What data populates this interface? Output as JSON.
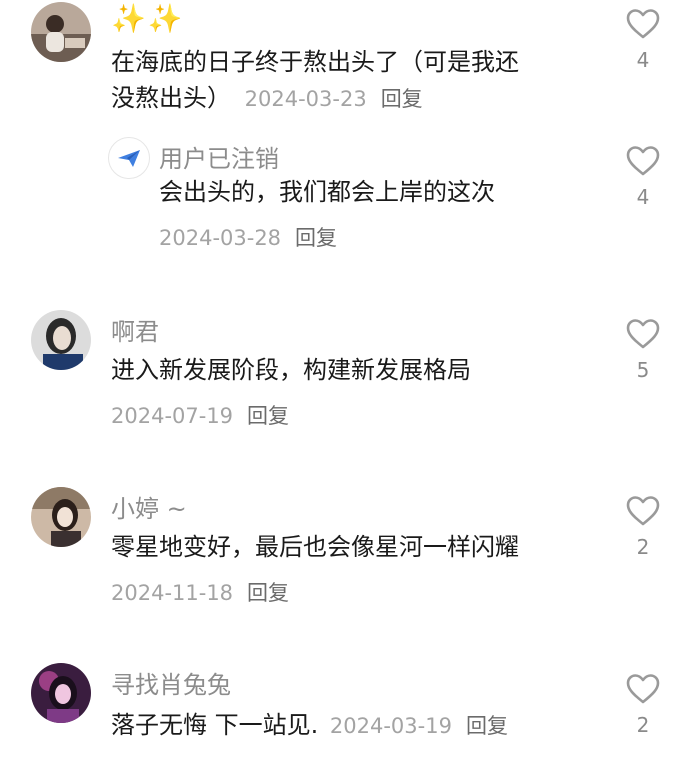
{
  "comments": [
    {
      "username": "✨✨",
      "content_part1": "在海底的日子终于熬出头了（可是我还",
      "content_part2": "没熬出头）",
      "date": "2024-03-23",
      "reply_label": "回复",
      "likes": "4",
      "reply": {
        "username": "用户已注销",
        "content": "会出头的，我们都会上岸的这次",
        "date": "2024-03-28",
        "reply_label": "回复",
        "likes": "4"
      }
    },
    {
      "username": "啊君",
      "content": "进入新发展阶段，构建新发展格局",
      "date": "2024-07-19",
      "reply_label": "回复",
      "likes": "5"
    },
    {
      "username": "小婷 ~",
      "content": "零星地变好，最后也会像星河一样闪耀",
      "date": "2024-11-18",
      "reply_label": "回复",
      "likes": "2"
    },
    {
      "username": "寻找肖兔兔",
      "content": "落子无悔 下一站见.",
      "date": "2024-03-19",
      "reply_label": "回复",
      "likes": "2"
    }
  ],
  "icons": {
    "like": "heart-outline-icon",
    "deleted_user": "paper-plane-icon"
  },
  "colors": {
    "username": "#8c8c8c",
    "meta": "#a3a3a3",
    "reply": "#6b6b6b",
    "heart_stroke": "#9a9a9a",
    "sparkle": "#f6c43a"
  }
}
